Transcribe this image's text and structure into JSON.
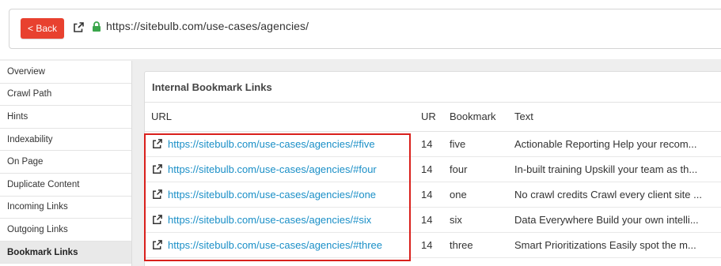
{
  "topbar": {
    "back_label": "< Back",
    "url": "https://sitebulb.com/use-cases/agencies/"
  },
  "sidebar": {
    "items": [
      {
        "label": "Overview",
        "active": false
      },
      {
        "label": "Crawl Path",
        "active": false
      },
      {
        "label": "Hints",
        "active": false
      },
      {
        "label": "Indexability",
        "active": false
      },
      {
        "label": "On Page",
        "active": false
      },
      {
        "label": "Duplicate Content",
        "active": false
      },
      {
        "label": "Incoming Links",
        "active": false
      },
      {
        "label": "Outgoing Links",
        "active": false
      },
      {
        "label": "Bookmark Links",
        "active": true
      }
    ]
  },
  "panel": {
    "title": "Internal Bookmark Links",
    "columns": [
      "URL",
      "UR",
      "Bookmark",
      "Text"
    ],
    "rows": [
      {
        "url": "https://sitebulb.com/use-cases/agencies/#five",
        "ur": "14",
        "bookmark": "five",
        "text": "Actionable Reporting Help your recom..."
      },
      {
        "url": "https://sitebulb.com/use-cases/agencies/#four",
        "ur": "14",
        "bookmark": "four",
        "text": "In-built training Upskill your team as th..."
      },
      {
        "url": "https://sitebulb.com/use-cases/agencies/#one",
        "ur": "14",
        "bookmark": "one",
        "text": "No crawl credits Crawl every client site ..."
      },
      {
        "url": "https://sitebulb.com/use-cases/agencies/#six",
        "ur": "14",
        "bookmark": "six",
        "text": "Data Everywhere Build your own intelli..."
      },
      {
        "url": "https://sitebulb.com/use-cases/agencies/#three",
        "ur": "14",
        "bookmark": "three",
        "text": "Smart Prioritizations Easily spot the m..."
      }
    ]
  },
  "colors": {
    "back_button": "#e8412f",
    "link": "#1a8fc7",
    "lock": "#3aa64b",
    "highlight": "#d9201c"
  },
  "icons": {
    "external": "external-link-icon",
    "lock": "lock-icon"
  }
}
